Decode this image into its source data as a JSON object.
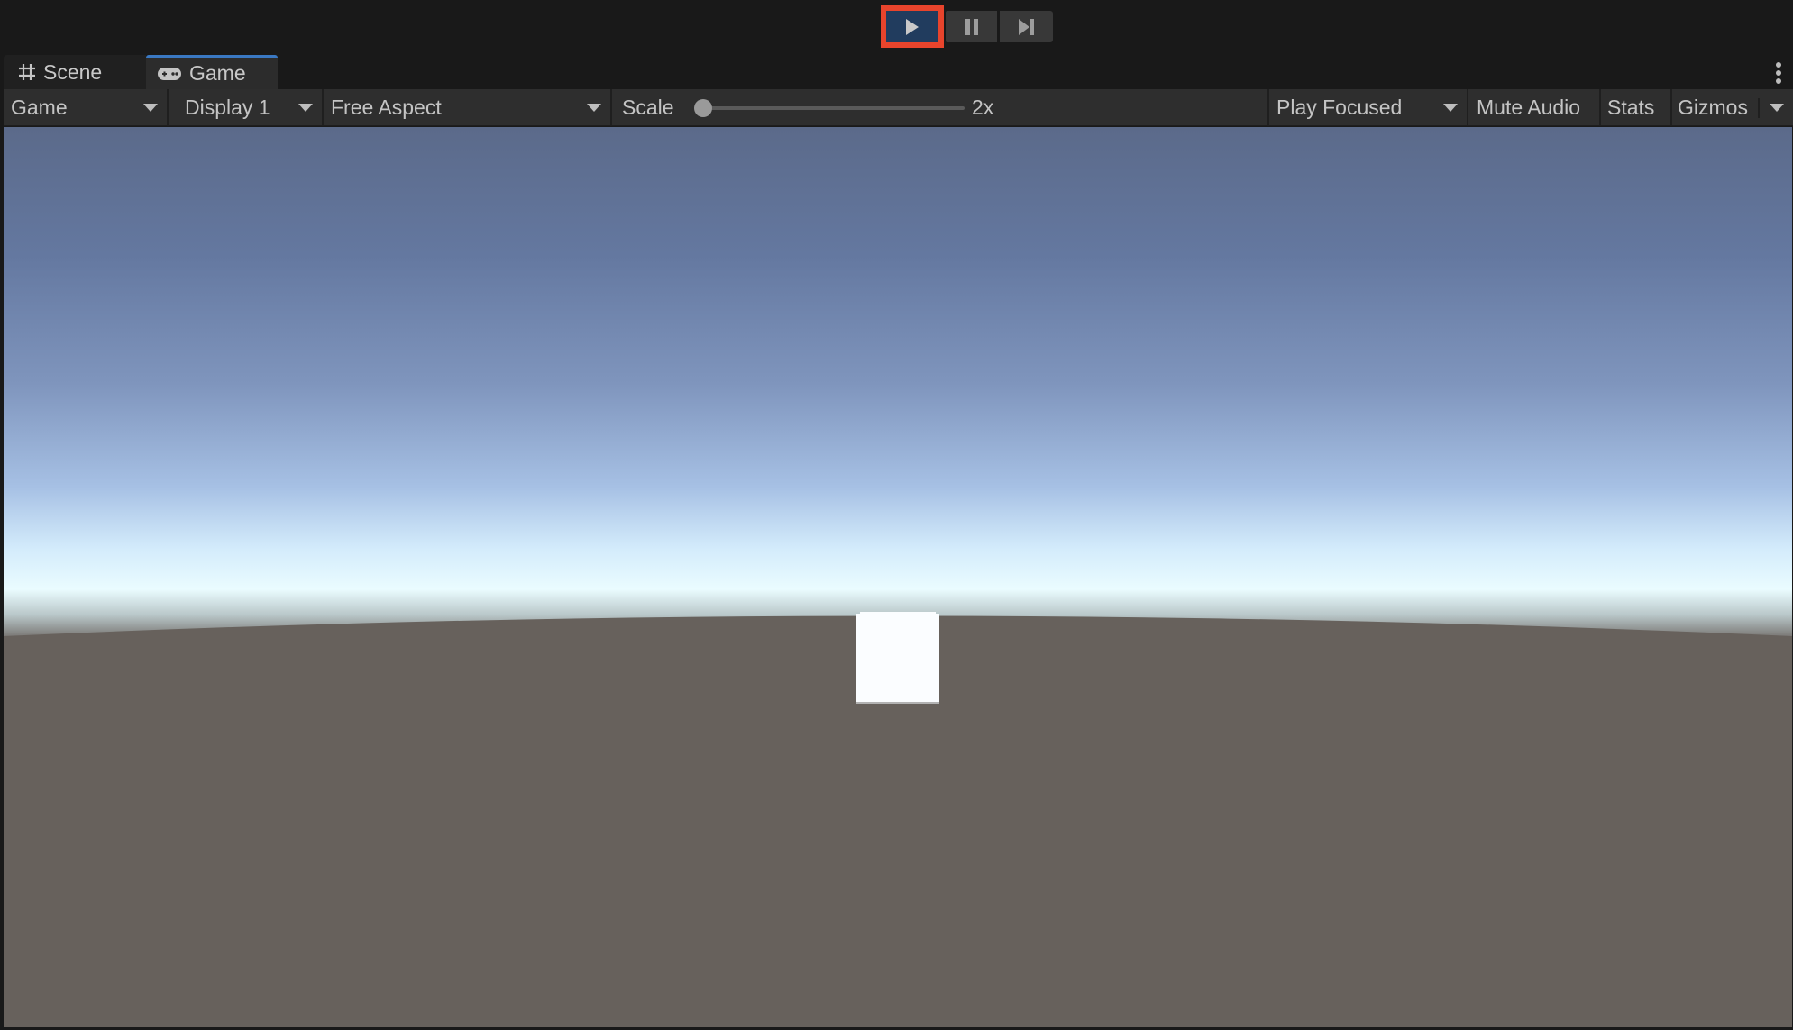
{
  "playbar": {
    "play_icon": "play-icon",
    "pause_icon": "pause-icon",
    "step_icon": "step-forward-icon",
    "play_active": true,
    "highlight_color": "#e8442c",
    "play_active_color": "#213c5e"
  },
  "tabs": [
    {
      "label": "Scene",
      "icon": "grid-icon",
      "selected": false
    },
    {
      "label": "Game",
      "icon": "gamepad-icon",
      "selected": true
    }
  ],
  "tab_menu_icon": "kebab-menu-icon",
  "toolbar": {
    "view_select": "Game",
    "display_select": "Display 1",
    "aspect_select": "Free Aspect",
    "scale_label": "Scale",
    "scale_value": "2x",
    "scale_slider_fraction": 0.0,
    "play_mode_select": "Play Focused",
    "mute_audio": "Mute Audio",
    "stats": "Stats",
    "gizmos": "Gizmos"
  },
  "viewport": {
    "sky_top_color": "#5b6a8a",
    "sky_horizon_color": "#eafcff",
    "ground_color": "#67615c",
    "object": "white-cube"
  }
}
